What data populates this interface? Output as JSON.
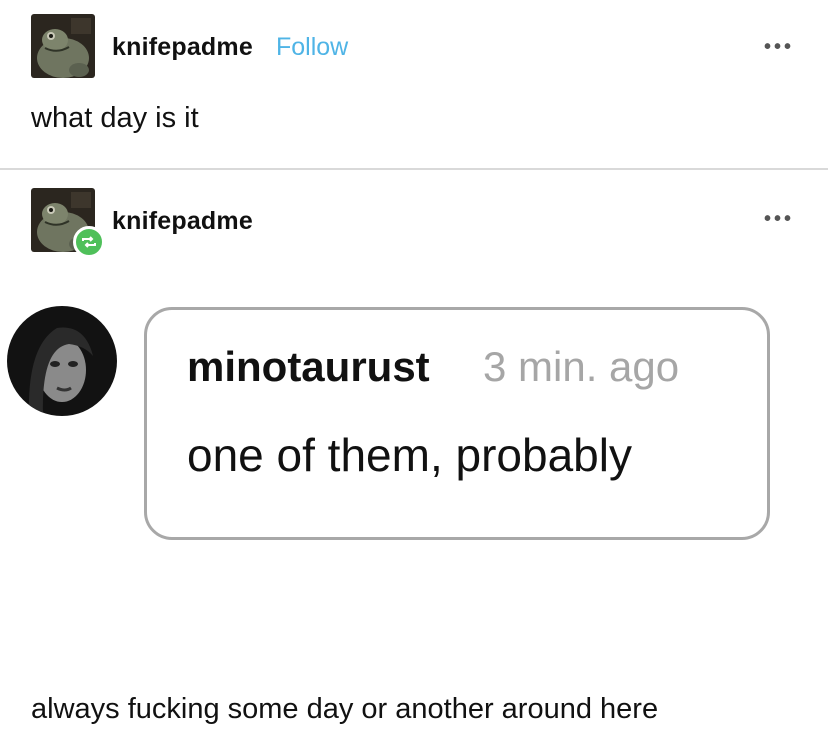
{
  "post": {
    "author": "knifepadme",
    "follow_label": "Follow",
    "more_label": "•••",
    "text": "what day is it"
  },
  "reblog": {
    "author": "knifepadme",
    "more_label": "•••",
    "quoted_message": {
      "username": "minotaurust",
      "time": "3 min. ago",
      "message": "one of them, probably"
    },
    "caption": "always fucking some day or another around here"
  },
  "colors": {
    "follow": "#4fb4e6",
    "reblog_badge": "#4fc05a",
    "divider": "#d9d9d9",
    "bubble_border": "#a8a8a8",
    "timestamp": "#a6a6a6"
  },
  "icons": {
    "post_avatar": "frog-avatar-icon",
    "reblog_badge": "reblog-icon",
    "more": "more-options-icon"
  }
}
